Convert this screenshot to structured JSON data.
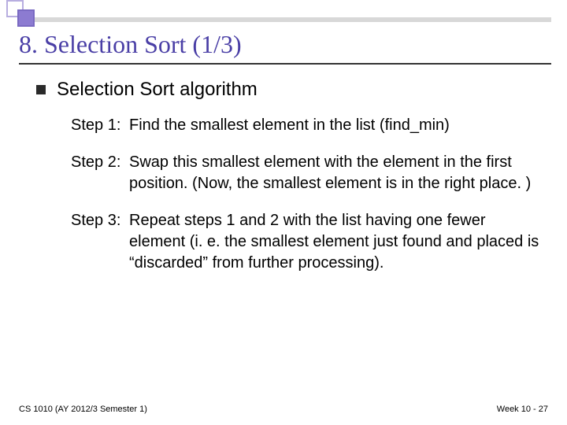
{
  "title": "8. Selection Sort (1/3)",
  "subheading": "Selection Sort algorithm",
  "steps": [
    {
      "label": "Step 1:",
      "body": "Find the smallest element in the list (find_min)"
    },
    {
      "label": "Step 2:",
      "body": "Swap this smallest element with the element in the first position. (Now, the smallest element is in the right place. )"
    },
    {
      "label": "Step 3:",
      "body": "Repeat steps 1 and 2 with the list having one fewer element (i. e. the smallest element just found and placed is “discarded” from further processing)."
    }
  ],
  "footer": {
    "left": "CS 1010 (AY 2012/3 Semester 1)",
    "right": "Week 10 - 27"
  }
}
